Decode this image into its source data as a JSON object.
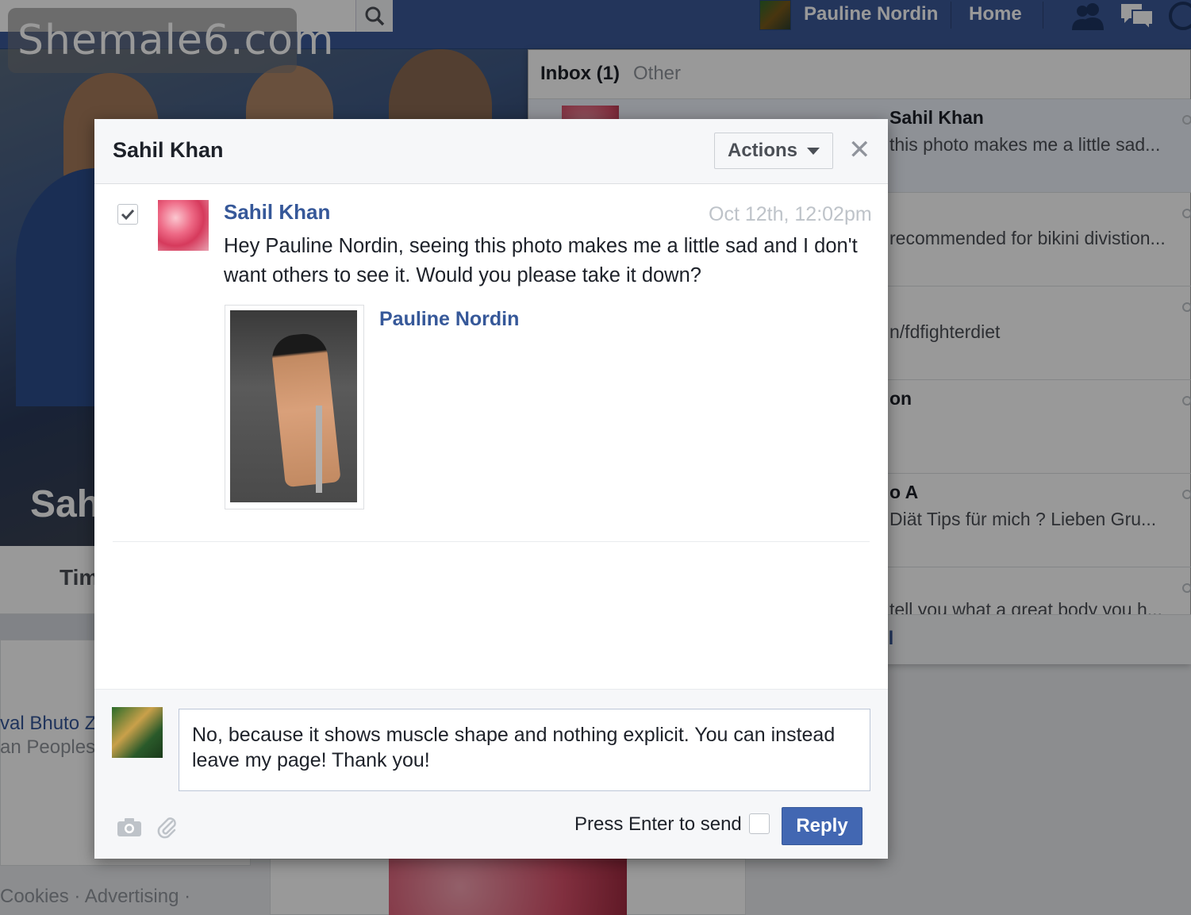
{
  "watermark": "Shemale6.com",
  "topbar": {
    "user_name": "Pauline Nordin",
    "home_label": "Home"
  },
  "profile": {
    "cover_name_partial": "Sah",
    "tab_partial": "Tim",
    "left_link_partial": "val Bhuto Za",
    "left_sub_partial": "an Peoples",
    "footer_links": "Cookies · Advertising ·"
  },
  "messages_dropdown": {
    "inbox_label": "Inbox (1)",
    "other_label": "Other",
    "rows": [
      {
        "title": "Sahil Khan",
        "snippet": "this photo makes me a little sad..."
      },
      {
        "title": "",
        "snippet": "recommended for bikini divistion..."
      },
      {
        "title": "",
        "snippet": "n/fdfighterdiet"
      },
      {
        "title": "on",
        "snippet": ""
      },
      {
        "title": "o A",
        "snippet": "Diät Tips für mich ? Lieben Gru..."
      },
      {
        "title": "",
        "snippet": "tell you what a great body you h..."
      }
    ],
    "see_all_partial": "ll"
  },
  "dialog": {
    "title": "Sahil Khan",
    "actions_label": "Actions",
    "close_glyph": "✕",
    "message": {
      "sender": "Sahil Khan",
      "time": "Oct 12th, 12:02pm",
      "text": "Hey Pauline Nordin, seeing this photo makes me a little sad and I don't want others to see it. Would you please take it down?",
      "attachment_name": "Pauline Nordin"
    },
    "reply": {
      "text": "No, because it shows muscle shape and nothing explicit. You can instead leave my page! Thank you!",
      "press_enter_label": "Press Enter to send",
      "press_enter_checked": false,
      "reply_label": "Reply"
    }
  },
  "colors": {
    "brand_blue": "#3b5998",
    "link_blue": "#365899",
    "reply_button": "#4267b2"
  }
}
